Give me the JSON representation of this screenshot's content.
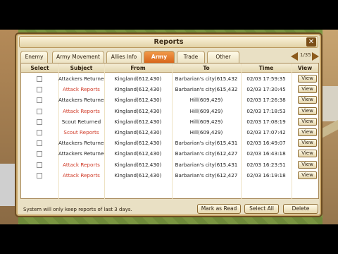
{
  "window": {
    "title": "Reports",
    "close_label": "✕"
  },
  "tabs": [
    "Enemy",
    "Army Movement",
    "Allies Info",
    "Army",
    "Trade",
    "Other"
  ],
  "active_tab": "Army",
  "pager": {
    "text": "1/35"
  },
  "table": {
    "headers": [
      "Select",
      "Subject",
      "From",
      "To",
      "Time",
      "View"
    ],
    "rows": [
      {
        "subject": "Attackers Returned",
        "from": "Kingland(612,430)",
        "to": "Barbarian's city(615,432",
        "time": "02/03 17:59:35",
        "view": "View",
        "kind": "normal"
      },
      {
        "subject": "Attack Reports",
        "from": "Kingland(612,430)",
        "to": "Barbarian's city(615,432",
        "time": "02/03 17:30:45",
        "view": "View",
        "kind": "attack"
      },
      {
        "subject": "Attackers Returned",
        "from": "Kingland(612,430)",
        "to": "Hill(609,429)",
        "time": "02/03 17:26:38",
        "view": "View",
        "kind": "normal"
      },
      {
        "subject": "Attack Reports",
        "from": "Kingland(612,430)",
        "to": "Hill(609,429)",
        "time": "02/03 17:18:53",
        "view": "View",
        "kind": "attack"
      },
      {
        "subject": "Scout Returned",
        "from": "Kingland(612,430)",
        "to": "Hill(609,429)",
        "time": "02/03 17:08:19",
        "view": "View",
        "kind": "normal"
      },
      {
        "subject": "Scout Reports",
        "from": "Kingland(612,430)",
        "to": "Hill(609,429)",
        "time": "02/03 17:07:42",
        "view": "View",
        "kind": "attack"
      },
      {
        "subject": "Attackers Returned",
        "from": "Kingland(612,430)",
        "to": "Barbarian's city(615,431",
        "time": "02/03 16:49:07",
        "view": "View",
        "kind": "normal"
      },
      {
        "subject": "Attackers Returned",
        "from": "Kingland(612,430)",
        "to": "Barbarian's city(612,427",
        "time": "02/03 16:43:18",
        "view": "View",
        "kind": "normal"
      },
      {
        "subject": "Attack Reports",
        "from": "Kingland(612,430)",
        "to": "Barbarian's city(615,431",
        "time": "02/03 16:23:51",
        "view": "View",
        "kind": "attack"
      },
      {
        "subject": "Attack Reports",
        "from": "Kingland(612,430)",
        "to": "Barbarian's city(612,427",
        "time": "02/03 16:19:18",
        "view": "View",
        "kind": "attack"
      }
    ]
  },
  "footer": {
    "note": "System will only keep reports of last 3 days.",
    "mark_as_read": "Mark as Read",
    "select_all": "Select All",
    "delete": "Delete"
  },
  "colors": {
    "attack_text": "#d03a27",
    "active_tab": "#e0742a",
    "frame": "#6d4d22"
  }
}
